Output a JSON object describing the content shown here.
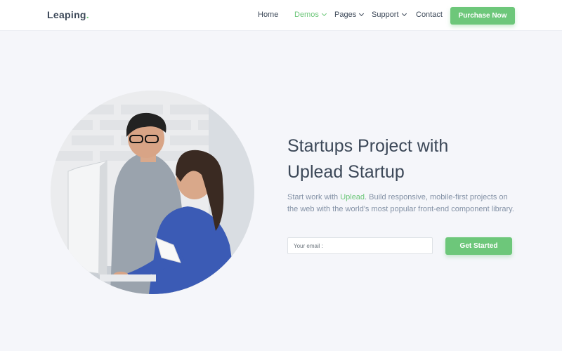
{
  "header": {
    "logo": "Leaping",
    "logo_dot": ".",
    "nav": [
      {
        "label": "Home",
        "active": false,
        "dropdown": false
      },
      {
        "label": "Demos",
        "active": true,
        "dropdown": true
      },
      {
        "label": "Pages",
        "active": false,
        "dropdown": true
      },
      {
        "label": "Support",
        "active": false,
        "dropdown": true
      },
      {
        "label": "Contact",
        "active": false,
        "dropdown": false
      }
    ],
    "cta_label": "Purchase Now"
  },
  "hero": {
    "title_line1": "Startups Project with",
    "title_line2": "Uplead Startup",
    "text_before": "Start work with ",
    "text_highlight": "Uplead",
    "text_after": ". Build responsive, mobile-first projects on the web with the world's most popular front-end component library.",
    "email_placeholder": "Your email :",
    "submit_label": "Get Started"
  },
  "colors": {
    "accent": "#6dc77a",
    "page_bg": "#f5f6fa",
    "heading": "#3c4858",
    "muted_text": "#8492a6"
  }
}
